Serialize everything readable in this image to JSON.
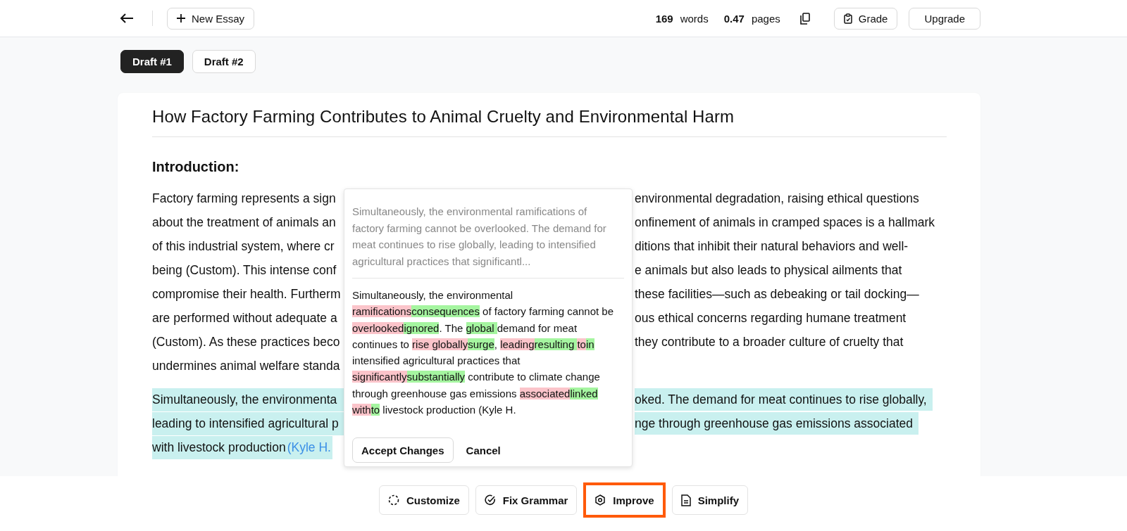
{
  "top_bar": {
    "new_essay": "New Essay",
    "word_count": "169",
    "words_label": "words",
    "page_count": "0.47",
    "pages_label": "pages",
    "grade": "Grade",
    "upgrade": "Upgrade"
  },
  "drafts": [
    {
      "label": "Draft #1",
      "selected": true
    },
    {
      "label": "Draft #2",
      "selected": false
    }
  ],
  "essay": {
    "title": "How Factory Farming Contributes to Animal Cruelty and Environmental Harm",
    "heading": "Introduction:",
    "paragraphs": [
      {
        "highlighted": false,
        "lines": [
          {
            "left": "Factory farming represents a sign",
            "right": "environmental degradation, raising ethical questions"
          },
          {
            "left": "about the treatment of animals an",
            "right": "onfinement of animals in cramped spaces is a hallmark"
          },
          {
            "left": "of this industrial system, where cr",
            "right": "ditions that inhibit their natural behaviors and well-"
          },
          {
            "left": "being (Custom). This intense conf",
            "right": "e animals but also leads to physical ailments that"
          },
          {
            "left": "compromise their health. Furtherm",
            "right": "these facilities—such as debeaking or tail docking—"
          },
          {
            "left": "are performed without adequate a",
            "right": "ous ethical concerns regarding humane treatment"
          },
          {
            "left": "(Custom). As these practices beco",
            "right": "they contribute to a broader culture of cruelty that"
          },
          {
            "left": "undermines animal welfare standa"
          }
        ]
      },
      {
        "highlighted": true,
        "lines": [
          {
            "left": "Simultaneously, the environmenta",
            "right": "oked. The demand for meat continues to rise globally,"
          },
          {
            "left": "leading to intensified agricultural p",
            "right": "nge through greenhouse gas emissions associated"
          },
          {
            "left": "with livestock production ",
            "citation": "(Kyle H."
          }
        ]
      }
    ]
  },
  "popup": {
    "original": "Simultaneously, the environmental ramifications of factory farming cannot be overlooked. The demand for meat continues to rise globally, leading to intensified agricultural practices that significantl...",
    "suggestion": [
      {
        "kind": "plain",
        "text": "Simultaneously, the environmental "
      },
      {
        "kind": "removed",
        "text": "ramifications"
      },
      {
        "kind": "added",
        "text": "consequences"
      },
      {
        "kind": "plain",
        "text": " of factory farming cannot be "
      },
      {
        "kind": "removed",
        "text": "overlooked"
      },
      {
        "kind": "added",
        "text": "ignored"
      },
      {
        "kind": "plain",
        "text": ". The "
      },
      {
        "kind": "added",
        "text": "global "
      },
      {
        "kind": "plain",
        "text": "demand for meat continues to "
      },
      {
        "kind": "removed",
        "text": "rise globally"
      },
      {
        "kind": "added",
        "text": "surge"
      },
      {
        "kind": "plain",
        "text": ", "
      },
      {
        "kind": "removed",
        "text": "leading"
      },
      {
        "kind": "added",
        "text": "resulting "
      },
      {
        "kind": "removed",
        "text": "to"
      },
      {
        "kind": "added",
        "text": "in"
      },
      {
        "kind": "plain",
        "text": " intensified agricultural practices that "
      },
      {
        "kind": "removed",
        "text": "significantly"
      },
      {
        "kind": "added",
        "text": "substantially"
      },
      {
        "kind": "plain",
        "text": " contribute to climate change through greenhouse gas emissions "
      },
      {
        "kind": "removed",
        "text": "associated"
      },
      {
        "kind": "added",
        "text": "linked "
      },
      {
        "kind": "removed",
        "text": "with"
      },
      {
        "kind": "added",
        "text": "to"
      },
      {
        "kind": "plain",
        "text": " livestock production (Kyle H."
      }
    ],
    "accept": "Accept Changes",
    "cancel": "Cancel"
  },
  "actions": [
    {
      "kind": "customize",
      "label": "Customize",
      "selected": false
    },
    {
      "kind": "grammar",
      "label": "Fix Grammar",
      "selected": false
    },
    {
      "kind": "improve",
      "label": "Improve",
      "selected": true
    },
    {
      "kind": "simplify",
      "label": "Simplify",
      "selected": false
    }
  ]
}
